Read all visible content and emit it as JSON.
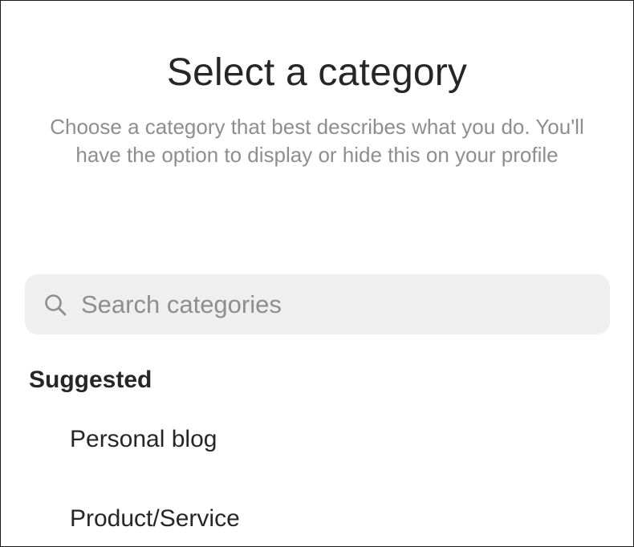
{
  "header": {
    "title": "Select a category",
    "subtitle": "Choose a category that best describes what you do. You'll have the option to display or hide this on your profile"
  },
  "search": {
    "placeholder": "Search categories",
    "value": "",
    "icon": "search-icon"
  },
  "suggested": {
    "heading": "Suggested",
    "items": [
      {
        "label": "Personal blog"
      },
      {
        "label": "Product/Service"
      }
    ]
  },
  "colors": {
    "text_primary": "#262626",
    "text_secondary": "#8e8e8e",
    "search_background": "#efefef",
    "background": "#ffffff"
  }
}
